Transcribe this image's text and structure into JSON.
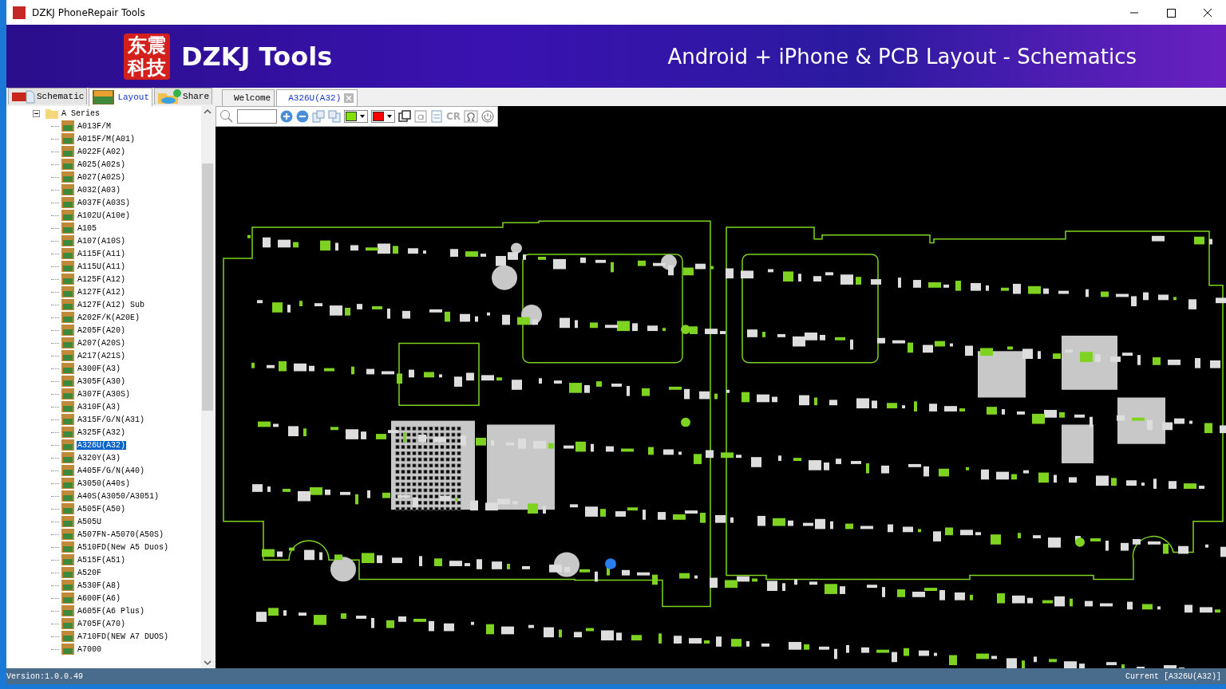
{
  "window": {
    "title": "DZKJ PhoneRepair Tools"
  },
  "banner": {
    "logo_text": "东震科技",
    "brand": "DZKJ Tools",
    "tagline": "Android + iPhone & PCB Layout - Schematics"
  },
  "side_tabs": [
    {
      "label": "Schematic",
      "selected": false,
      "kind": "pdf"
    },
    {
      "label": "Layout",
      "selected": true,
      "kind": "pads"
    },
    {
      "label": "Share",
      "selected": false,
      "kind": "share"
    }
  ],
  "doc_tabs": [
    {
      "label": "Welcome",
      "selected": false,
      "closable": false
    },
    {
      "label": "A326U(A32)",
      "selected": true,
      "closable": true
    }
  ],
  "tree": {
    "folder": {
      "label": "A Series",
      "expanded": true
    },
    "items": [
      {
        "label": "A013F/M",
        "selected": false
      },
      {
        "label": "A015F/M(A01)",
        "selected": false
      },
      {
        "label": "A022F(A02)",
        "selected": false
      },
      {
        "label": "A025(A02s)",
        "selected": false
      },
      {
        "label": "A027(A02S)",
        "selected": false
      },
      {
        "label": "A032(A03)",
        "selected": false
      },
      {
        "label": "A037F(A03S)",
        "selected": false
      },
      {
        "label": "A102U(A10e)",
        "selected": false
      },
      {
        "label": "A105",
        "selected": false
      },
      {
        "label": "A107(A10S)",
        "selected": false
      },
      {
        "label": "A115F(A11)",
        "selected": false
      },
      {
        "label": "A115U(A11)",
        "selected": false
      },
      {
        "label": "A125F(A12)",
        "selected": false
      },
      {
        "label": "A127F(A12)",
        "selected": false
      },
      {
        "label": "A127F(A12) Sub",
        "selected": false
      },
      {
        "label": "A202F/K(A20E)",
        "selected": false
      },
      {
        "label": "A205F(A20)",
        "selected": false
      },
      {
        "label": "A207(A20S)",
        "selected": false
      },
      {
        "label": "A217(A21S)",
        "selected": false
      },
      {
        "label": "A300F(A3)",
        "selected": false
      },
      {
        "label": "A305F(A30)",
        "selected": false
      },
      {
        "label": "A307F(A30S)",
        "selected": false
      },
      {
        "label": "A310F(A3)",
        "selected": false
      },
      {
        "label": "A315F/G/N(A31)",
        "selected": false
      },
      {
        "label": "A325F(A32)",
        "selected": false
      },
      {
        "label": "A326U(A32)",
        "selected": true
      },
      {
        "label": "A320Y(A3)",
        "selected": false
      },
      {
        "label": "A405F/G/N(A40)",
        "selected": false
      },
      {
        "label": "A3050(A40s)",
        "selected": false
      },
      {
        "label": "A40S(A3050/A3051)",
        "selected": false
      },
      {
        "label": "A505F(A50)",
        "selected": false
      },
      {
        "label": "A505U",
        "selected": false
      },
      {
        "label": "A507FN-A5070(A50S)",
        "selected": false
      },
      {
        "label": "A510FD(New A5 Duos)",
        "selected": false
      },
      {
        "label": "A515F(A51)",
        "selected": false
      },
      {
        "label": "A520F",
        "selected": false
      },
      {
        "label": "A530F(A8)",
        "selected": false
      },
      {
        "label": "A600F(A6)",
        "selected": false
      },
      {
        "label": "A605F(A6 Plus)",
        "selected": false
      },
      {
        "label": "A705F(A70)",
        "selected": false
      },
      {
        "label": "A710FD(NEW A7 DUOS)",
        "selected": false
      },
      {
        "label": "A7000",
        "selected": false
      }
    ]
  },
  "toolbar": {
    "swatches": [
      {
        "color": "#80e000"
      },
      {
        "color": "#ff0000"
      }
    ],
    "cr_label": "CR"
  },
  "status_bar": {
    "version": "Version:1.0.0.49",
    "current": "Current [A326U(A32)]"
  }
}
